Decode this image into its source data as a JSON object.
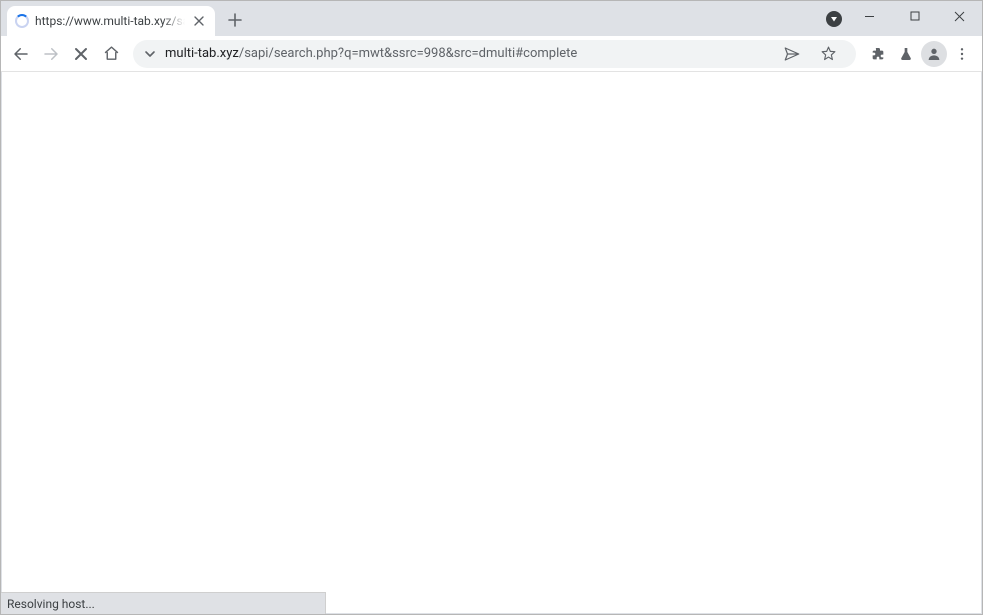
{
  "tab": {
    "title": "https://www.multi-tab.xyz/sapi/s"
  },
  "url": {
    "domain": "multi-tab.xyz",
    "path": "/sapi/search.php?q=mwt&ssrc=998&src=dmulti#complete"
  },
  "status": {
    "text": "Resolving host..."
  }
}
